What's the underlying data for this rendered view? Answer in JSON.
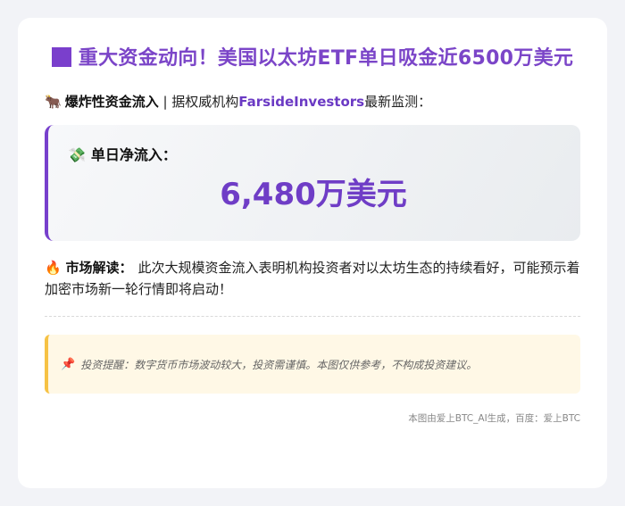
{
  "header": {
    "title": "重大资金动向！美国以太坊ETF单日吸金近6500万美元"
  },
  "intro": {
    "emoji": "🐂",
    "label": "爆炸性资金流入",
    "separator": " | 据权威机构",
    "org": "FarsideInvestors",
    "suffix": "最新监测："
  },
  "inflow": {
    "emoji": "💸",
    "label": "单日净流入：",
    "amount": "6,480万美元"
  },
  "analysis": {
    "emoji": "🔥",
    "label": "市场解读：",
    "text": "此次大规模资金流入表明机构投资者对以太坊生态的持续看好，可能预示着加密市场新一轮行情即将启动！"
  },
  "tip": {
    "emoji": "📌",
    "text": "投资提醒：数字货币市场波动较大，投资需谨慎。本图仅供参考，不构成投资建议。"
  },
  "footer": {
    "text": "本图由爱上BTC_AI生成，百度：爱上BTC"
  },
  "colors": {
    "accent": "#7b45c8",
    "tip_border": "#f6c244",
    "tip_bg": "#fff8e6"
  }
}
